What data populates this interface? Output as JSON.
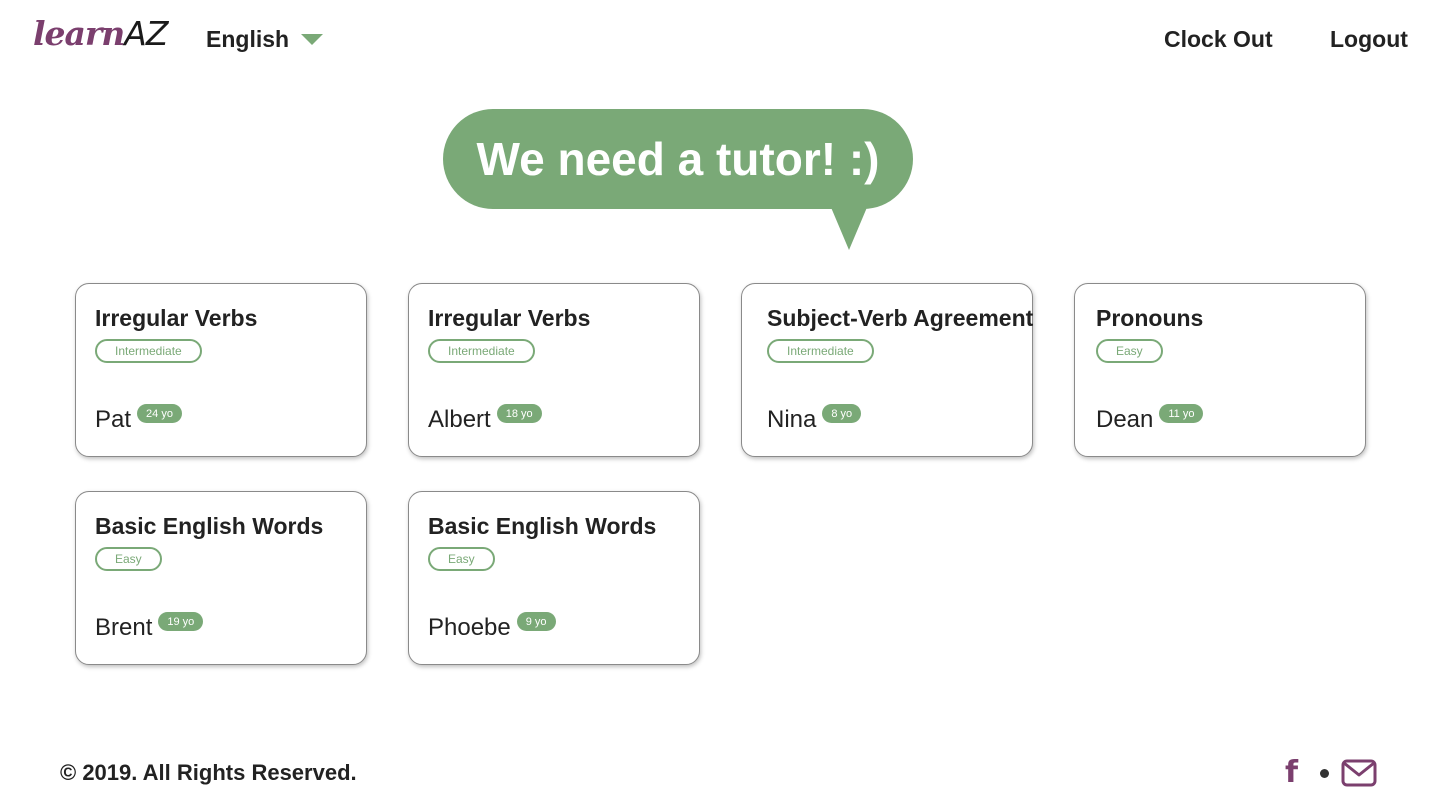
{
  "header": {
    "logo_learn": "learn",
    "logo_az": "AZ",
    "language": "English",
    "clock_out": "Clock Out",
    "logout": "Logout"
  },
  "banner": {
    "text": "We need a tutor! :)"
  },
  "cards": [
    {
      "title": "Irregular Verbs",
      "level": "Intermediate",
      "student": "Pat",
      "age": "24 yo"
    },
    {
      "title": "Irregular Verbs",
      "level": "Intermediate",
      "student": "Albert",
      "age": "18 yo"
    },
    {
      "title": "Subject-Verb Agreement",
      "level": "Intermediate",
      "student": "Nina",
      "age": "8 yo"
    },
    {
      "title": "Pronouns",
      "level": "Easy",
      "student": "Dean",
      "age": "11 yo"
    },
    {
      "title": "Basic English Words",
      "level": "Easy",
      "student": "Brent",
      "age": "19 yo"
    },
    {
      "title": "Basic English Words",
      "level": "Easy",
      "student": "Phoebe",
      "age": "9 yo"
    }
  ],
  "footer": {
    "copyright": "© 2019. All Rights Reserved.",
    "facebook_icon": "f",
    "icons": [
      "facebook-icon",
      "mail-icon"
    ]
  },
  "colors": {
    "accent_green": "#7aa977",
    "brand_purple": "#7b3f6e",
    "text": "#222222"
  }
}
